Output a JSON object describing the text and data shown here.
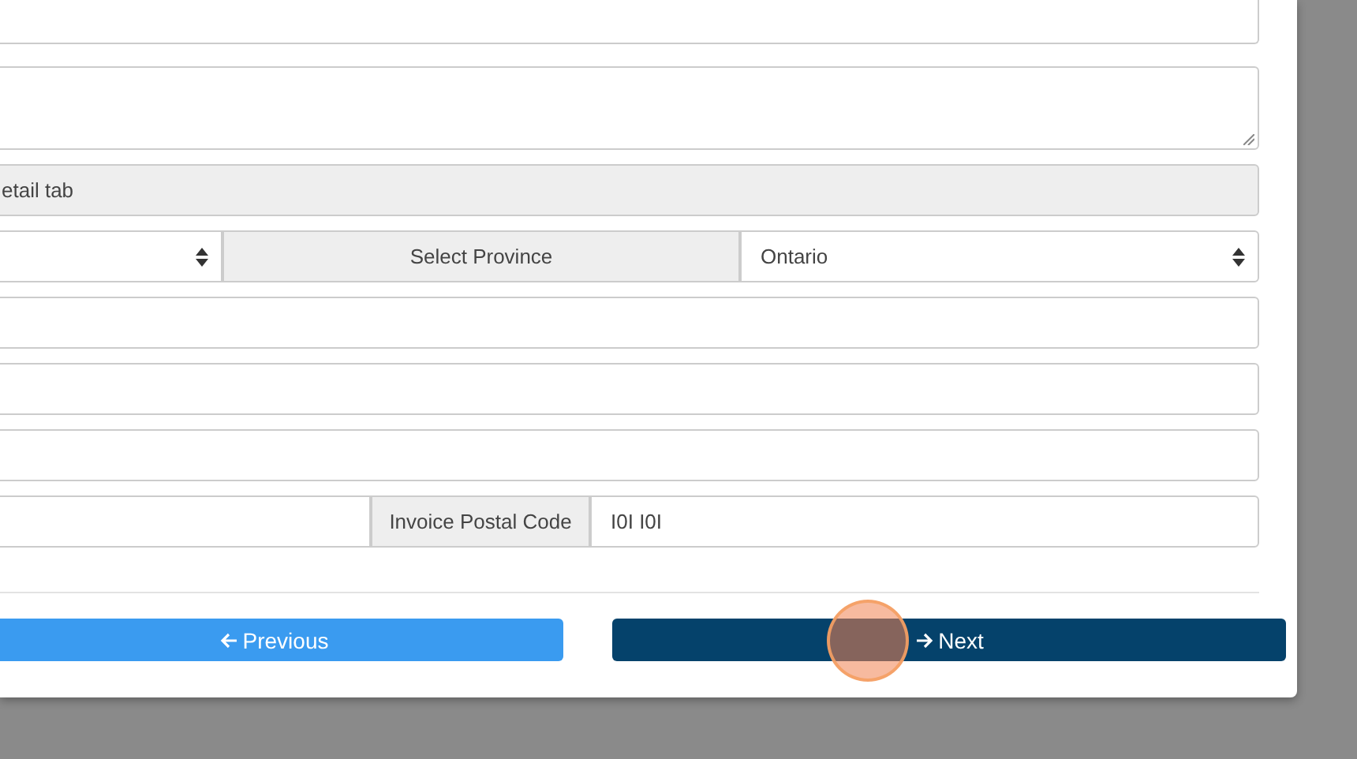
{
  "form_rows": [
    {
      "kind": "input"
    },
    {
      "kind": "textarea"
    },
    {
      "kind": "note",
      "text": "etail tab"
    },
    {
      "kind": "select_group",
      "addon": "Select Province",
      "value": "Ontario"
    },
    {
      "kind": "input"
    },
    {
      "kind": "input"
    },
    {
      "kind": "input"
    },
    {
      "kind": "input_group",
      "addon": "Invoice Postal Code",
      "value": "I0I I0I"
    }
  ],
  "buttons": [
    {
      "label": "Previous",
      "kind": "previous"
    },
    {
      "label": "Next",
      "kind": "next"
    }
  ]
}
